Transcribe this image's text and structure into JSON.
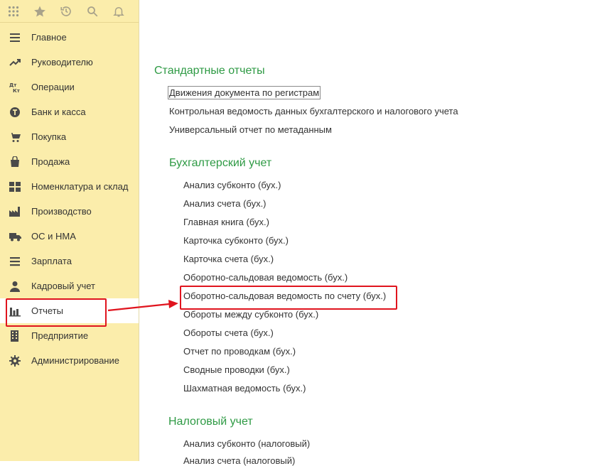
{
  "sidebar": {
    "toolbar": [
      {
        "icon": "apps-grid-icon"
      },
      {
        "icon": "star-icon"
      },
      {
        "icon": "history-icon"
      },
      {
        "icon": "search-icon"
      },
      {
        "icon": "bell-icon"
      }
    ],
    "items": [
      {
        "label": "Главное",
        "icon": "menu-lines-icon"
      },
      {
        "label": "Руководителю",
        "icon": "trend-icon"
      },
      {
        "label": "Операции",
        "icon": "dt-kt-icon"
      },
      {
        "label": "Банк и касса",
        "icon": "bank-icon"
      },
      {
        "label": "Покупка",
        "icon": "cart-icon"
      },
      {
        "label": "Продажа",
        "icon": "bag-icon"
      },
      {
        "label": "Номенклатура и склад",
        "icon": "grid-icon"
      },
      {
        "label": "Производство",
        "icon": "factory-icon"
      },
      {
        "label": "ОС и НМА",
        "icon": "truck-icon"
      },
      {
        "label": "Зарплата",
        "icon": "salary-icon"
      },
      {
        "label": "Кадровый учет",
        "icon": "person-icon"
      },
      {
        "label": "Отчеты",
        "icon": "bar-chart-icon",
        "active": true
      },
      {
        "label": "Предприятие",
        "icon": "building-icon"
      },
      {
        "label": "Администрирование",
        "icon": "gear-icon"
      }
    ]
  },
  "main": {
    "standard": {
      "title": "Стандартные отчеты",
      "links": [
        "Движения документа по регистрам",
        "Контрольная ведомость данных бухгалтерского и налогового учета",
        "Универсальный отчет по метаданным"
      ]
    },
    "accounting": {
      "title": "Бухгалтерский учет",
      "links": [
        "Анализ субконто (бух.)",
        "Анализ счета (бух.)",
        "Главная книга (бух.)",
        "Карточка субконто (бух.)",
        "Карточка счета (бух.)",
        "Оборотно-сальдовая ведомость (бух.)",
        "Оборотно-сальдовая ведомость по счету (бух.)",
        "Обороты между субконто (бух.)",
        "Обороты счета (бух.)",
        "Отчет по проводкам (бух.)",
        "Сводные проводки (бух.)",
        "Шахматная ведомость (бух.)"
      ]
    },
    "tax": {
      "title": "Налоговый учет",
      "links": [
        "Анализ субконто (налоговый)",
        "Анализ счета (налоговый)"
      ]
    }
  },
  "colors": {
    "sidebar_bg": "#fbedab",
    "section_title": "#2e9a44",
    "highlight": "#e0141e"
  }
}
